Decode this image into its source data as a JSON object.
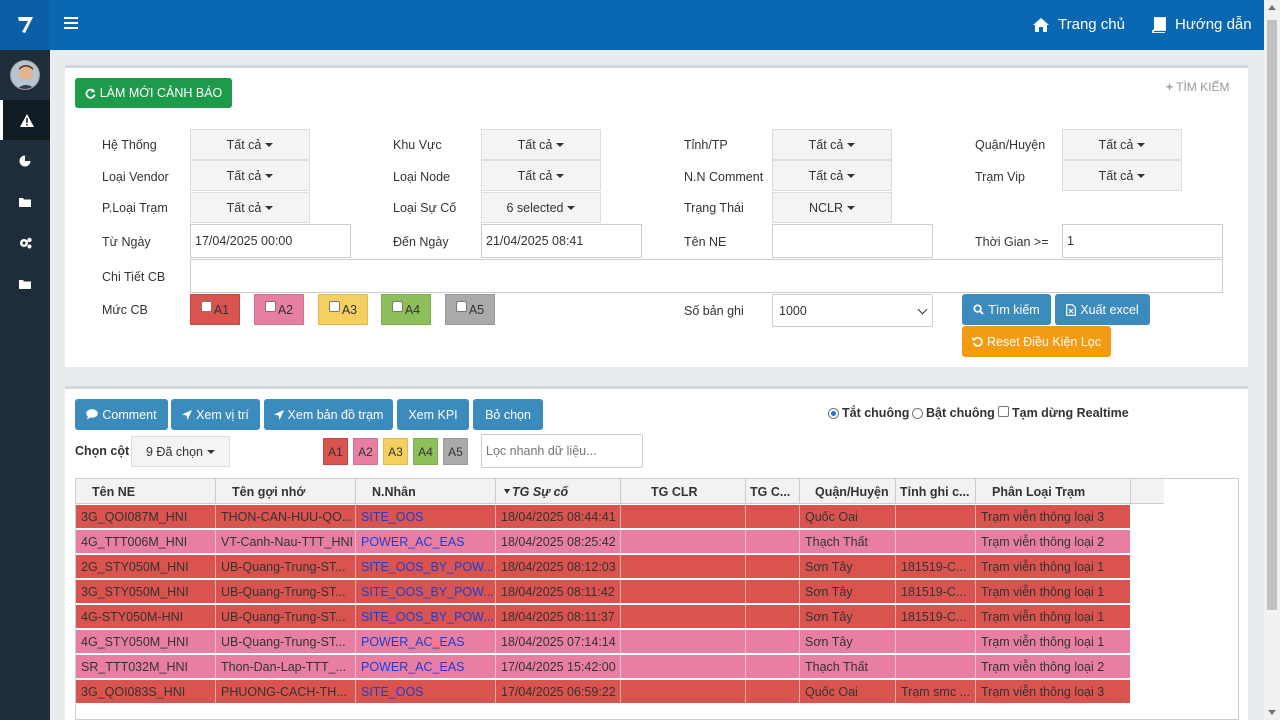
{
  "topbar": {
    "home": "Trang chủ",
    "guide": "Hướng dẫn"
  },
  "sidebar": {
    "icons": [
      "warning-icon",
      "pie-chart-icon",
      "folder-icon",
      "settings-icon",
      "folder-icon"
    ]
  },
  "filter": {
    "refresh_button": "LÀM MỚI CẢNH BÁO",
    "search_toggle": "TÌM KIẾM",
    "fields": {
      "he_thong": {
        "label": "Hệ Thống",
        "value": "Tất cả"
      },
      "khu_vuc": {
        "label": "Khu Vực",
        "value": "Tất cả"
      },
      "tinh_tp": {
        "label": "Tỉnh/TP",
        "value": "Tất cả"
      },
      "quan_huyen": {
        "label": "Quận/Huyện",
        "value": "Tất cả"
      },
      "loai_vendor": {
        "label": "Loại Vendor",
        "value": "Tất cả"
      },
      "loai_node": {
        "label": "Loại Node",
        "value": "Tất cả"
      },
      "nn_comment": {
        "label": "N.N Comment",
        "value": "Tất cả"
      },
      "tram_vip": {
        "label": "Trạm Vip",
        "value": "Tất cả"
      },
      "ploai_tram": {
        "label": "P.Loại Trạm",
        "value": "Tất cả"
      },
      "loai_su_co": {
        "label": "Loại Sự Cố",
        "value": "6 selected"
      },
      "trang_thai": {
        "label": "Trạng Thái",
        "value": "NCLR"
      }
    },
    "tu_ngay": {
      "label": "Từ Ngày",
      "value": "17/04/2025 00:00"
    },
    "den_ngay": {
      "label": "Đến Ngày",
      "value": "21/04/2025 08:41"
    },
    "ten_ne": {
      "label": "Tên NE",
      "value": ""
    },
    "thoi_gian": {
      "label": "Thời Gian >=",
      "value": "1"
    },
    "chi_tiet": {
      "label": "Chi Tiết CB",
      "value": ""
    },
    "muc_cb": {
      "label": "Mức CB",
      "levels": [
        "A1",
        "A2",
        "A3",
        "A4",
        "A5"
      ]
    },
    "so_ban_ghi": {
      "label": "Số bản ghi",
      "value": "1000"
    },
    "search_button": "Tìm kiếm",
    "export_button": "Xuất excel",
    "reset_button": "Reset Điều Kiện Lọc"
  },
  "colors": {
    "A1": "#d9534f",
    "A2": "#e87fa3",
    "A3": "#f5d060",
    "A4": "#8fbf5a",
    "A5": "#aaaaaa"
  },
  "toolbar": {
    "comment": "Comment",
    "location": "Xem vị trí",
    "map": "Xem bản đồ trạm",
    "kpi": "Xem KPI",
    "deselect": "Bỏ chọn",
    "mute": "Tắt chuông",
    "unmute": "Bật chuông",
    "pause": "Tạm dừng Realtime",
    "columns_label": "Chọn cột",
    "columns_value": "9 Đã chọn",
    "tags": [
      "A1",
      "A2",
      "A3",
      "A4",
      "A5"
    ],
    "quick_filter_placeholder": "Lọc nhanh dữ liệu..."
  },
  "grid": {
    "headers": [
      "Tên NE",
      "Tên gợi nhớ",
      "N.Nhân",
      "TG Sự cố",
      "TG CLR",
      "TG C...",
      "Quận/Huyện",
      "Tỉnh ghi c...",
      "Phân Loại Trạm"
    ],
    "rows": [
      {
        "level": "A1",
        "cells": [
          "3G_QOI087M_HNI",
          "THON-CAN-HUU-QO...",
          "SITE_OOS",
          "18/04/2025 08:44:41",
          "",
          "",
          "Quốc Oai",
          "",
          "Trạm viễn thông loại 3"
        ]
      },
      {
        "level": "A2",
        "cells": [
          "4G_TTT006M_HNI",
          "VT-Canh-Nau-TTT_HNI",
          "POWER_AC_EAS",
          "18/04/2025 08:25:42",
          "",
          "",
          "Thạch Thất",
          "",
          "Trạm viễn thông loại 2"
        ]
      },
      {
        "level": "A1",
        "cells": [
          "2G_STY050M_HNI",
          "UB-Quang-Trung-ST...",
          "SITE_OOS_BY_POW...",
          "18/04/2025 08:12:03",
          "",
          "",
          "Sơn Tây",
          "181519-C...",
          "Trạm viễn thông loại 1"
        ]
      },
      {
        "level": "A1",
        "cells": [
          "3G_STY050M_HNI",
          "UB-Quang-Trung-ST...",
          "SITE_OOS_BY_POW...",
          "18/04/2025 08:11:42",
          "",
          "",
          "Sơn Tây",
          "181519-C...",
          "Trạm viễn thông loại 1"
        ]
      },
      {
        "level": "A1",
        "cells": [
          "4G-STY050M-HNI",
          "UB-Quang-Trung-ST...",
          "SITE_OOS_BY_POW...",
          "18/04/2025 08:11:37",
          "",
          "",
          "Sơn Tây",
          "181519-C...",
          "Trạm viễn thông loại 1"
        ]
      },
      {
        "level": "A2",
        "cells": [
          "4G_STY050M_HNI",
          "UB-Quang-Trung-ST...",
          "POWER_AC_EAS",
          "18/04/2025 07:14:14",
          "",
          "",
          "Sơn Tây",
          "",
          "Trạm viễn thông loại 1"
        ]
      },
      {
        "level": "A2",
        "cells": [
          "SR_TTT032M_HNI",
          "Thon-Dan-Lap-TTT_...",
          "POWER_AC_EAS",
          "17/04/2025 15:42:00",
          "",
          "",
          "Thạch Thất",
          "",
          "Trạm viễn thông loại 2"
        ]
      },
      {
        "level": "A1",
        "cells": [
          "3G_QOI083S_HNI",
          "PHUONG-CACH-TH...",
          "SITE_OOS",
          "17/04/2025 06:59:22",
          "",
          "",
          "Quốc Oai",
          "Trạm smc ...",
          "Trạm viễn thông loại 3"
        ]
      }
    ]
  }
}
